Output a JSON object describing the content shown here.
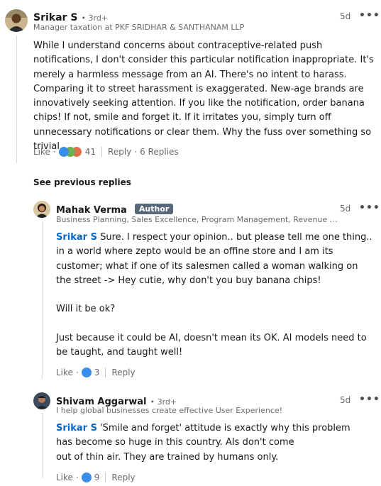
{
  "comment1": {
    "author": "Srikar S",
    "degree": "• 3rd+",
    "headline": "Manager taxation at PKF SRIDHAR & SANTHANAM LLP",
    "time": "5d",
    "more": "•••",
    "text": "While I understand concerns about contraceptive-related push notifications, I don't consider this particular notification inappropriate. It's merely a harmless message from an AI. There's no intent to harass. Comparing it to street harassment is exaggerated. New-age brands are innovatively seeking attention. If you like the notification, order banana chips! If not, smile and forget it. If it irritates you, simply turn off unnecessary notifications or clear them. Why the fuss over something so trivial",
    "like_label": "Like",
    "reaction_count": "41",
    "reply_label": "Reply",
    "replies_count": "6 Replies"
  },
  "see_previous": "See previous replies",
  "reply1": {
    "author": "Mahak Verma",
    "badge": "Author",
    "headline": "Business Planning, Sales Excellence, Program Management, Revenue M...",
    "time": "5d",
    "more": "•••",
    "mention": "Srikar S",
    "para1": " Sure. I respect your opinion.. but please tell me one thing.. in a world where zepto would be an offine store and I am its customer; what if one of its salesmen called a woman walking on the street -> Hey cutie, why don't you buy banana chips!",
    "para2": "Will it be ok?",
    "para3": "Just because it could be AI, doesn't mean its OK. AI models need to be taught, and taught well!",
    "like_label": "Like",
    "reaction_count": "3",
    "reply_label": "Reply"
  },
  "reply2": {
    "author": "Shivam Aggarwal",
    "degree": "• 3rd+",
    "headline": "I help global businesses create effective User Experience!",
    "time": "5d",
    "more": "•••",
    "mention": "Srikar S",
    "line1": " 'Smile and forget' attitude is exactly why this problem has become so huge in this country. AIs don't come",
    "line2": "out of thin air. They are trained by humans only.",
    "like_label": "Like",
    "reaction_count": "9",
    "reply_label": "Reply"
  },
  "colors": {
    "mention": "#0a66c2",
    "badge": "#56687a",
    "like_blue": "#378fe9",
    "celebrate": "#6dae4f",
    "love": "#df704d"
  }
}
